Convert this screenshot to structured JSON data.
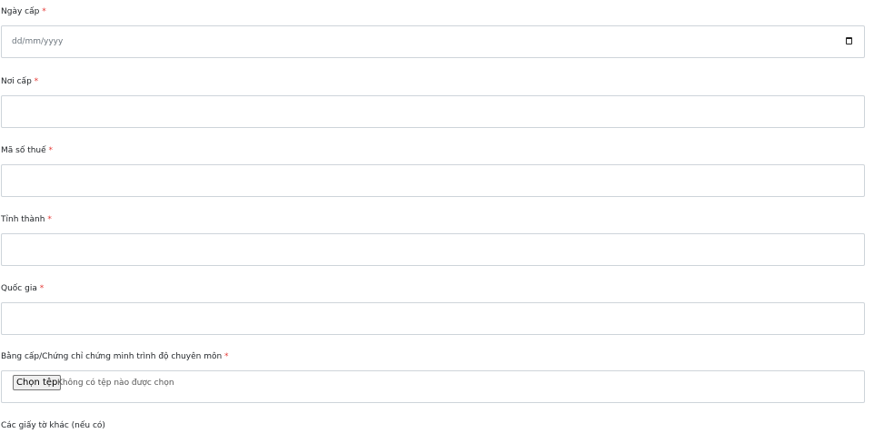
{
  "form": {
    "issue_date": {
      "label": "Ngày cấp",
      "required_mark": "*",
      "placeholder": "dd/mm/yyyy",
      "value": ""
    },
    "issue_place": {
      "label": "Nơi cấp",
      "required_mark": "*",
      "value": ""
    },
    "tax_code": {
      "label": "Mã số thuế",
      "required_mark": "*",
      "value": ""
    },
    "province": {
      "label": "Tỉnh thành",
      "required_mark": "*",
      "value": ""
    },
    "country": {
      "label": "Quốc gia",
      "required_mark": "*",
      "value": ""
    },
    "certificate": {
      "label": "Bằng cấp/Chứng chỉ chứng minh trình độ chuyên môn",
      "required_mark": "*",
      "button_label": "Chọn tệp",
      "status_text": "Không có tệp nào được chọn"
    },
    "other_documents": {
      "label": "Các giấy tờ khác (nếu có)"
    }
  },
  "icons": {
    "date_picker": "calendar-icon"
  },
  "colors": {
    "required_mark": "#e53935",
    "input_border": "#ced4da"
  }
}
